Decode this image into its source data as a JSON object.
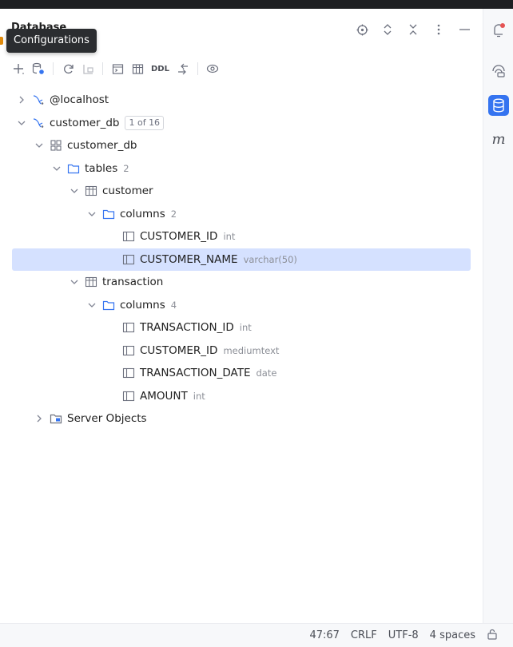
{
  "panel": {
    "title": "Database"
  },
  "tooltip": {
    "text": "Configurations"
  },
  "toolbar": {
    "ddl_label": "DDL"
  },
  "tree": {
    "localhost": {
      "label": "@localhost"
    },
    "customer_db_ds": {
      "label": "customer_db",
      "badge": "1 of 16"
    },
    "customer_db_schema": {
      "label": "customer_db"
    },
    "tables": {
      "label": "tables",
      "count": "2"
    },
    "customer": {
      "label": "customer"
    },
    "customer_columns": {
      "label": "columns",
      "count": "2"
    },
    "customer_id": {
      "label": "CUSTOMER_ID",
      "type": "int"
    },
    "customer_name": {
      "label": "CUSTOMER_NAME",
      "type": "varchar(50)"
    },
    "transaction": {
      "label": "transaction"
    },
    "transaction_columns": {
      "label": "columns",
      "count": "4"
    },
    "transaction_id": {
      "label": "TRANSACTION_ID",
      "type": "int"
    },
    "tx_customer_id": {
      "label": "CUSTOMER_ID",
      "type": "mediumtext"
    },
    "transaction_date": {
      "label": "TRANSACTION_DATE",
      "type": "date"
    },
    "amount": {
      "label": "AMOUNT",
      "type": "int"
    },
    "server_objects": {
      "label": "Server Objects"
    }
  },
  "right_bar": {
    "m_label": "m"
  },
  "status": {
    "position": "47:67",
    "line_endings": "CRLF",
    "encoding": "UTF-8",
    "indent": "4 spaces"
  },
  "colors": {
    "selection": "#d5e1ff",
    "accent": "#3574f0",
    "notification": "#e55353"
  }
}
